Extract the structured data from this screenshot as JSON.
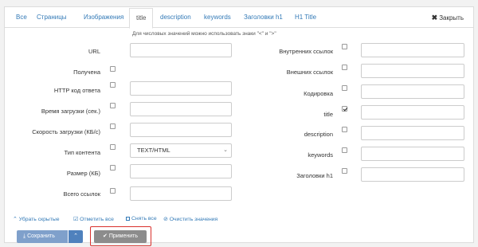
{
  "tabs": [
    {
      "label": "Все"
    },
    {
      "label": "Страницы"
    },
    {
      "label": "Изображения"
    },
    {
      "label": "title"
    },
    {
      "label": "description"
    },
    {
      "label": "keywords"
    },
    {
      "label": "Заголовки h1"
    },
    {
      "label": "H1 Title"
    }
  ],
  "active_tab": "title",
  "close_label": "Закрыть",
  "hint": "Для числовых значений можно использовать знаки \"<\" и \">\"",
  "left_fields": [
    {
      "label": "URL"
    },
    {
      "label": "Получена",
      "checked": false
    },
    {
      "label": "HTTP код ответа",
      "checked": false,
      "value": ""
    },
    {
      "label": "Время загрузки (сек.)",
      "checked": false,
      "value": ""
    },
    {
      "label": "Скорость загрузки (КБ/с)",
      "checked": false,
      "value": ""
    },
    {
      "label": "Тип контента",
      "checked": false,
      "value": "TEXT/HTML"
    },
    {
      "label": "Размер (КБ)",
      "checked": false,
      "value": ""
    },
    {
      "label": "Всего ссылок",
      "checked": false,
      "value": ""
    }
  ],
  "right_fields": [
    {
      "label": "Внутренних ссылок",
      "checked": false,
      "value": ""
    },
    {
      "label": "Внешних ссылок",
      "checked": false,
      "value": ""
    },
    {
      "label": "Кодировка",
      "checked": false,
      "value": ""
    },
    {
      "label": "title",
      "checked": true,
      "value": ""
    },
    {
      "label": "description",
      "checked": false,
      "value": ""
    },
    {
      "label": "keywords",
      "checked": false,
      "value": ""
    },
    {
      "label": "Заголовки h1",
      "checked": false,
      "value": ""
    }
  ],
  "links": {
    "hide_hidden": "Убрать скрытые",
    "check_all": "Отметить все",
    "uncheck_all": "Снять все",
    "clear_values": "Очистить значения"
  },
  "buttons": {
    "save": "Сохранить",
    "apply": "Применить"
  },
  "colors": {
    "link": "#337ab7",
    "save_button": "#7fa0cb",
    "save_caret": "#4f81bd",
    "apply_button": "#8c8c8c",
    "highlight_outline": "#d9302c"
  }
}
